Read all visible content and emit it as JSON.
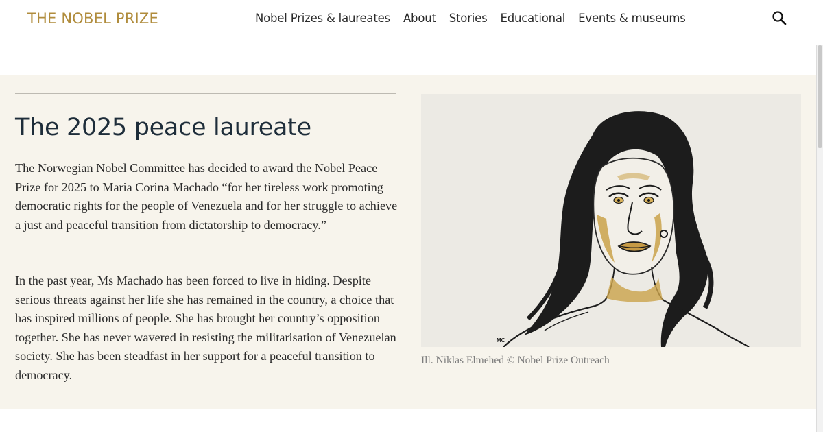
{
  "header": {
    "logo": "THE NOBEL PRIZE",
    "nav": [
      "Nobel Prizes & laureates",
      "About",
      "Stories",
      "Educational",
      "Events & museums"
    ],
    "search_icon": "search-icon"
  },
  "article": {
    "title": "The 2025 peace laureate",
    "paragraph1": "The Norwegian Nobel Committee has decided to award the Nobel Peace Prize for 2025 to Maria Corina Machado “for her tireless work promoting democratic rights for the people of Venezuela and for her struggle to achieve a just and peaceful transition from dictatorship to democracy.”",
    "paragraph2": "In the past year, Ms Machado has been forced to live in hiding. Despite serious threats against her life she has remained in the country, a choice that has inspired millions of people. She has brought her country’s opposition together. She has never wavered in resisting the militarisation of Venezuelan society. She has been steadfast in her support for a peaceful transition to democracy."
  },
  "image": {
    "signature": "MC",
    "caption": "Ill. Niklas Elmehed © Nobel Prize Outreach"
  },
  "colors": {
    "brand_gold": "#b08c3c",
    "hero_background": "#f7f4ec",
    "title_ink": "#1e2d3a"
  }
}
